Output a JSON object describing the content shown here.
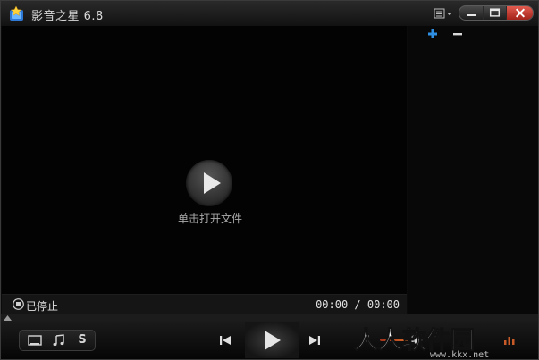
{
  "window": {
    "title": "影音之星 6.8"
  },
  "video": {
    "open_file_label": "单击打开文件"
  },
  "status": {
    "state": "已停止",
    "time": "00:00 / 00:00"
  },
  "playlist": {
    "add_icon": "plus-icon",
    "remove_icon": "minus-icon"
  },
  "controls": {
    "mode_s_label": "S",
    "volume_level": 0.82
  },
  "watermark": {
    "url": "www.kkx.net",
    "logo_text": "人人软件园"
  },
  "colors": {
    "accent_blue": "#2e8fe3",
    "close_red": "#c0392b",
    "volume_orange": "#e0762e"
  }
}
